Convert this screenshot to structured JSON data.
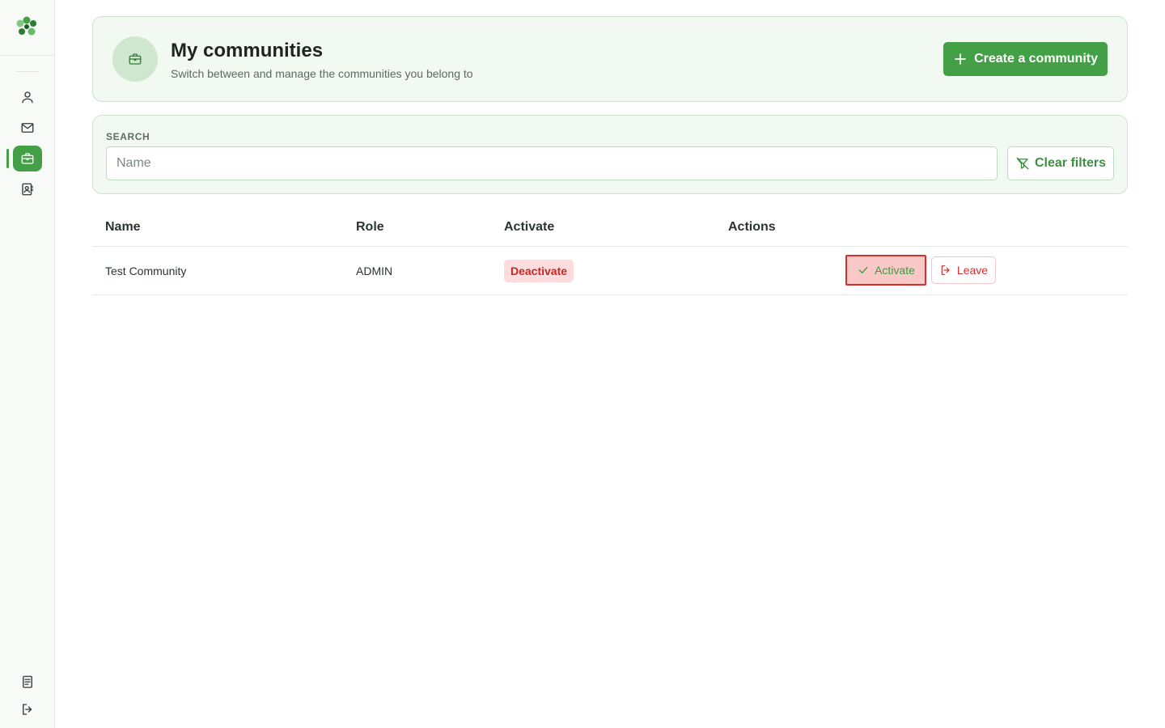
{
  "sidebar": {
    "nav_items": [
      {
        "icon": "user-icon"
      },
      {
        "icon": "mail-icon"
      },
      {
        "icon": "briefcase-icon",
        "active": true
      },
      {
        "icon": "contact-book-icon"
      }
    ],
    "bottom_items": [
      {
        "icon": "document-icon"
      },
      {
        "icon": "logout-icon"
      }
    ]
  },
  "header": {
    "title": "My communities",
    "subtitle": "Switch between and manage the communities you belong to",
    "create_button": "Create a community"
  },
  "search": {
    "label": "SEARCH",
    "placeholder": "Name",
    "value": "",
    "clear_button": "Clear filters"
  },
  "table": {
    "columns": [
      "Name",
      "Role",
      "Activate",
      "Actions"
    ],
    "rows": [
      {
        "name": "Test Community",
        "role": "ADMIN",
        "activate_badge": "Deactivate",
        "actions": {
          "activate": "Activate",
          "leave": "Leave"
        }
      }
    ]
  },
  "colors": {
    "primary": "#43a047",
    "danger": "#d32f2f",
    "card_bg": "#f2f9f2"
  }
}
